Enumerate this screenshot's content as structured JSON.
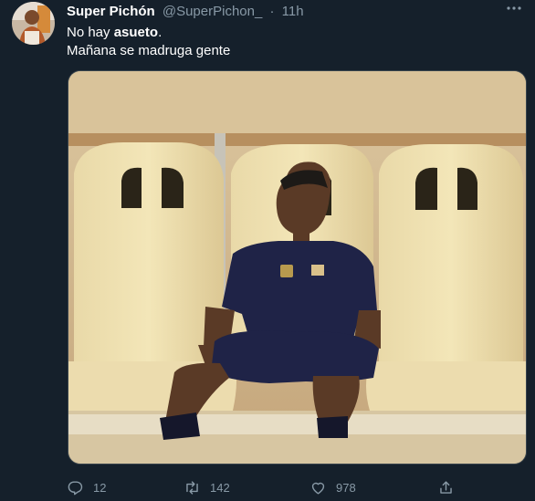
{
  "tweet": {
    "display_name": "Super Pichón",
    "handle": "@SuperPichon_",
    "separator": "·",
    "time": "11h",
    "more_icon": "ellipsis-icon",
    "text_line1_prefix": "No hay ",
    "text_line1_bold": "asueto",
    "text_line1_suffix": ".",
    "text_line2": "Mañana se madruga gente"
  },
  "actions": {
    "replies": "12",
    "retweets": "142",
    "likes": "978"
  },
  "colors": {
    "background": "#15202b",
    "secondary_text": "#8899a6",
    "border": "#38444d"
  }
}
